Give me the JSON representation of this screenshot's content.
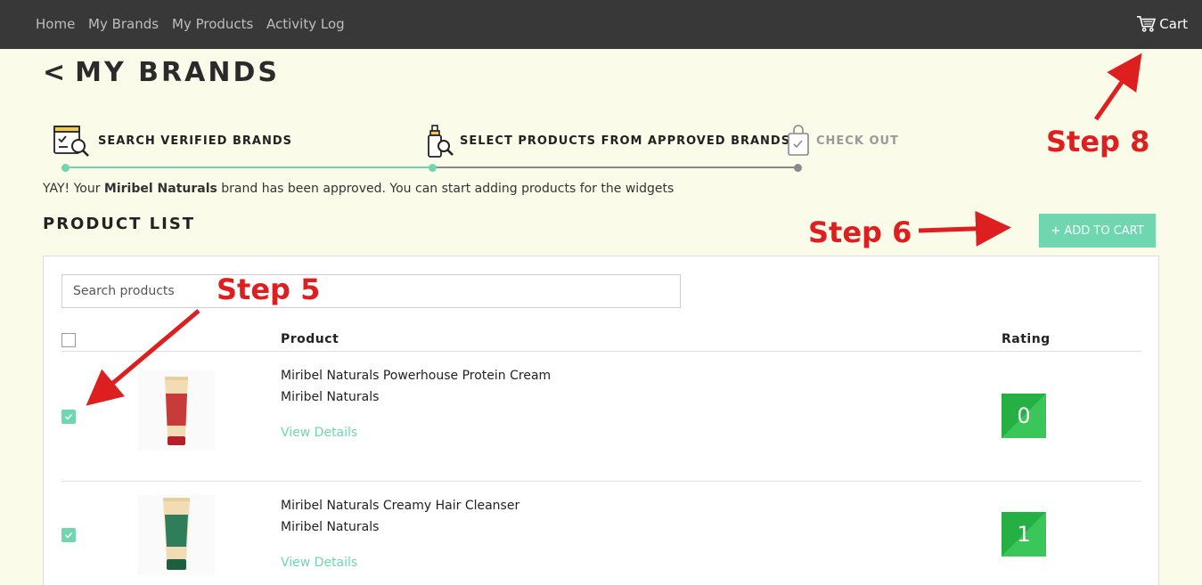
{
  "nav": {
    "items": [
      "Home",
      "My Brands",
      "My Products",
      "Activity Log"
    ],
    "cart_label": "Cart"
  },
  "page": {
    "back_symbol": "<",
    "title": "MY BRANDS"
  },
  "stepper": {
    "steps": [
      {
        "label": "SEARCH VERIFIED BRANDS",
        "state": "done",
        "icon": "search-brands-icon"
      },
      {
        "label": "SELECT PRODUCTS FROM APPROVED BRANDS",
        "state": "active",
        "icon": "serum-search-icon"
      },
      {
        "label": "CHECK OUT",
        "state": "pending",
        "icon": "shopping-bag-icon"
      }
    ],
    "colors": {
      "done": "#6fd6b0",
      "active": "#222222",
      "pending": "#9a9a9a"
    }
  },
  "approval": {
    "prefix": "YAY! Your ",
    "brand": "Miribel Naturals",
    "suffix": " brand has been approved. You can start adding products for the widgets"
  },
  "product_list": {
    "title": "PRODUCT LIST",
    "add_button": "+ ADD TO CART",
    "search_placeholder": "Search products",
    "columns": {
      "product": "Product",
      "rating": "Rating"
    },
    "rows": [
      {
        "name": "Miribel Naturals Powerhouse Protein Cream",
        "brand": "Miribel Naturals",
        "link": "View Details",
        "rating": "0",
        "checked": true
      },
      {
        "name": "Miribel Naturals Creamy Hair Cleanser",
        "brand": "Miribel Naturals",
        "link": "View Details",
        "rating": "1",
        "checked": true
      }
    ]
  },
  "annotations": {
    "step5": "Step 5",
    "step6": "Step 6",
    "step8": "Step 8",
    "color": "#dd1f1f"
  },
  "colors": {
    "accent": "#6fd6b0",
    "topbar": "#383838",
    "background": "#fbfbea",
    "rating_green": "#2bb84a"
  }
}
